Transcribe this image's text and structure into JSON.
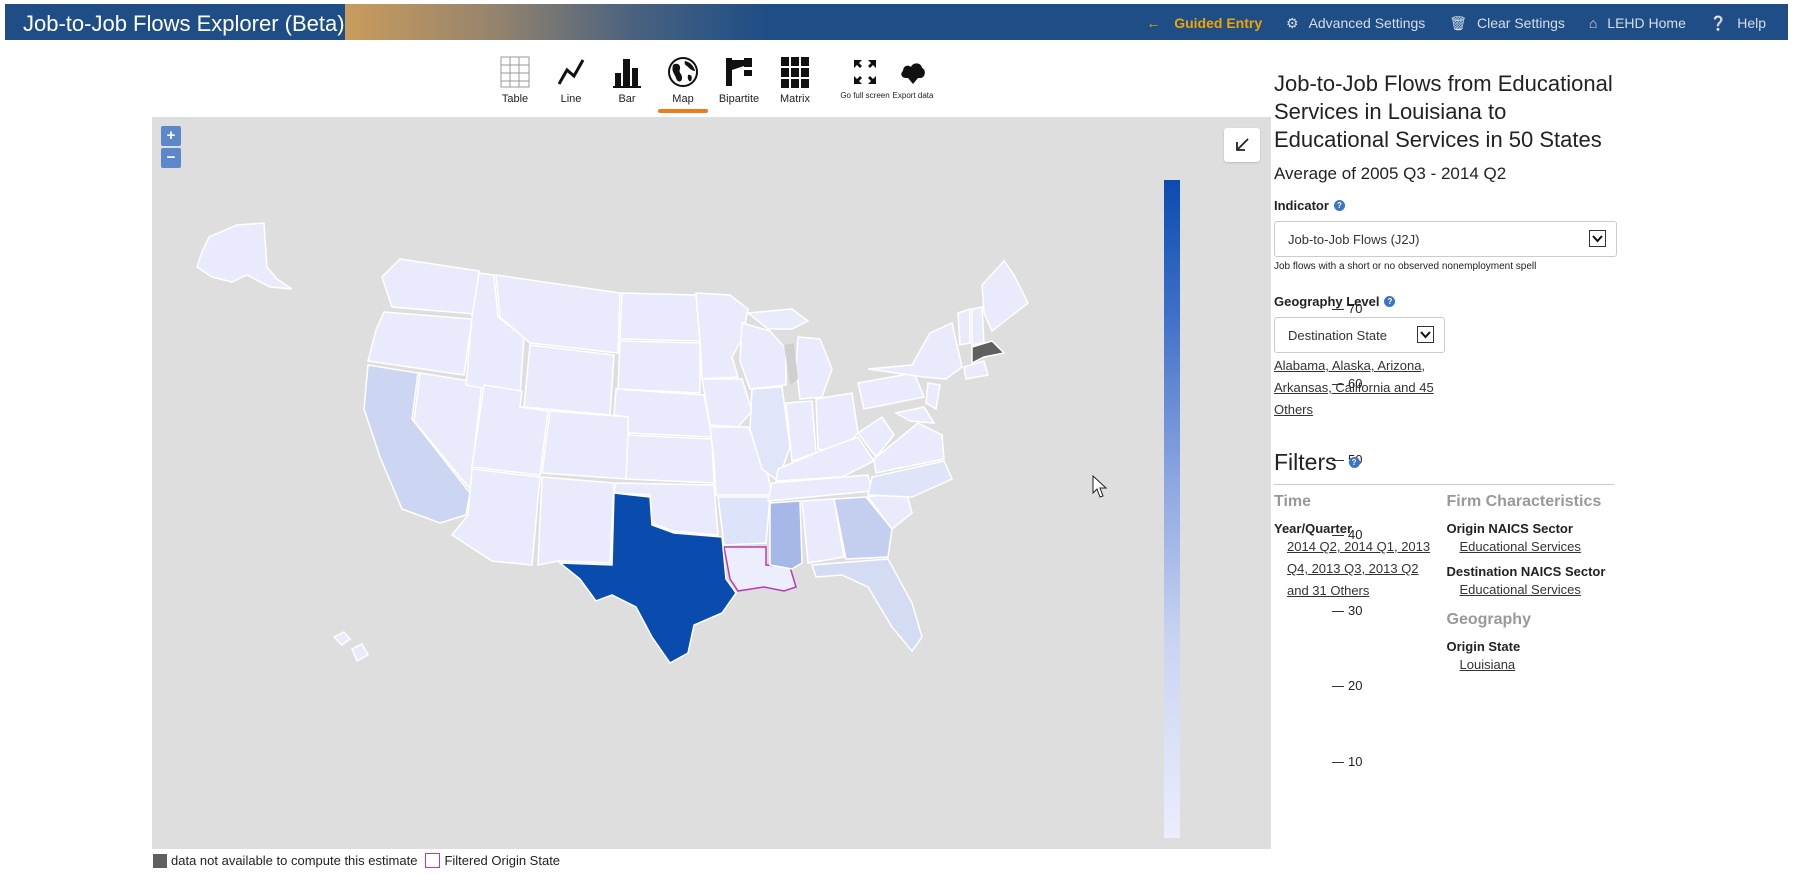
{
  "header": {
    "title": "Job-to-Job Flows Explorer (Beta)",
    "nav": {
      "guided_entry": "Guided Entry",
      "advanced_settings": "Advanced Settings",
      "clear_settings": "Clear Settings",
      "lehd_home": "LEHD Home",
      "help": "Help"
    }
  },
  "toolbar": {
    "tools": [
      {
        "label": "Table",
        "icon": "table-icon"
      },
      {
        "label": "Line",
        "icon": "line-chart-icon"
      },
      {
        "label": "Bar",
        "icon": "bar-chart-icon"
      },
      {
        "label": "Map",
        "icon": "globe-icon",
        "active": true
      },
      {
        "label": "Bipartite",
        "icon": "bipartite-icon"
      },
      {
        "label": "Matrix",
        "icon": "matrix-icon"
      },
      {
        "label": "Go full screen",
        "icon": "fullscreen-icon"
      },
      {
        "label": "Export data",
        "icon": "cloud-download-icon"
      }
    ]
  },
  "map": {
    "zoom_in": "+",
    "zoom_out": "−",
    "legend": {
      "ticks": [
        "80",
        "70",
        "60",
        "50",
        "40",
        "30",
        "20",
        "10"
      ],
      "color_high": "#0a4cae",
      "color_low": "#ecedfd"
    },
    "footer": {
      "na_label": "data not available to compute this estimate",
      "filtered_label": "Filtered Origin State",
      "na_color": "#5f5f5f",
      "filtered_color": "#b83cb5"
    }
  },
  "panel": {
    "title": "Job-to-Job Flows from Educational Services in Louisiana to Educational Services in 50 States",
    "period": "Average of 2005 Q3 - 2014 Q2",
    "indicator_label": "Indicator",
    "indicator_value": "Job-to-Job Flows (J2J)",
    "indicator_note": "Job flows with a short or no observed nonemployment spell",
    "geo_level_label": "Geography Level",
    "geo_level_value": "Destination State",
    "geo_states_link": "Alabama, Alaska, Arizona, Arkansas, California and 45 Others",
    "filters_title": "Filters",
    "time_heading": "Time",
    "year_quarter_label": "Year/Quarter",
    "year_quarter_value": "2014 Q2, 2014 Q1, 2013 Q4, 2013 Q3, 2013 Q2 and 31 Others",
    "firm_heading": "Firm Characteristics",
    "origin_naics_label": "Origin NAICS Sector",
    "origin_naics_value": "Educational Services",
    "dest_naics_label": "Destination NAICS Sector",
    "dest_naics_value": "Educational Services",
    "geography_heading": "Geography",
    "origin_state_label": "Origin State",
    "origin_state_value": "Louisiana"
  }
}
